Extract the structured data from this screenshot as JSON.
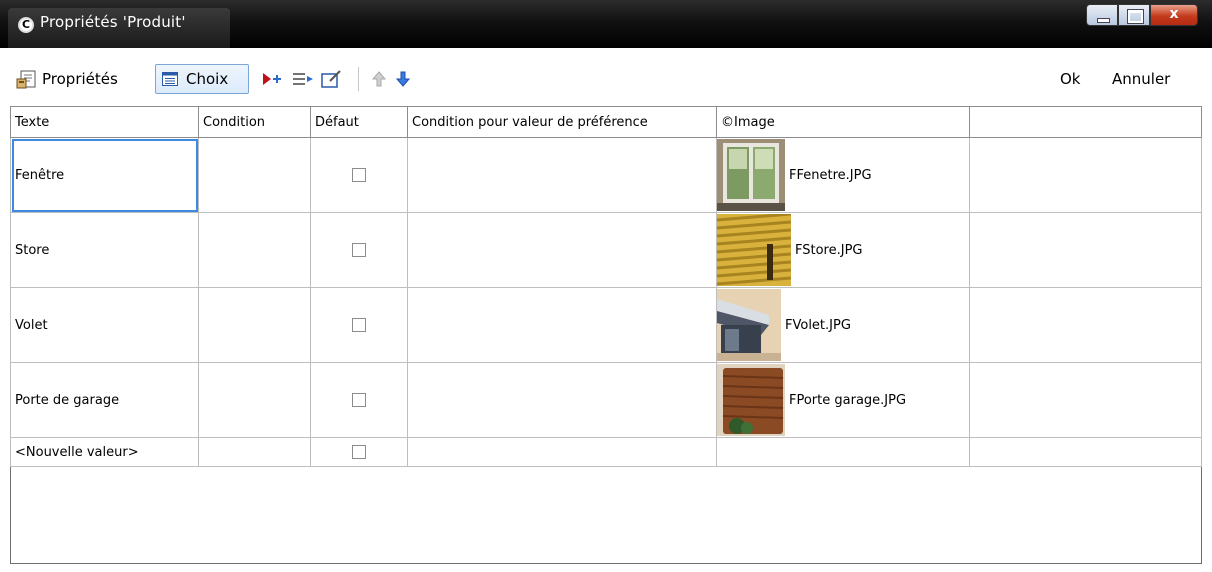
{
  "window": {
    "icon_letter": "C",
    "title": "Propriétés 'Produit'",
    "close_glyph": "x"
  },
  "toolbar": {
    "properties_label": "Propriétés",
    "choices_label": "Choix",
    "ok_label": "Ok",
    "cancel_label": "Annuler"
  },
  "table": {
    "headers": [
      "Texte",
      "Condition",
      "Défaut",
      "Condition pour valeur de préférence",
      "©Image",
      ""
    ],
    "rows": [
      {
        "text": "Fenêtre",
        "condition": "",
        "default": false,
        "preference": "",
        "image": "FFenetre.JPG"
      },
      {
        "text": "Store",
        "condition": "",
        "default": false,
        "preference": "",
        "image": "FStore.JPG"
      },
      {
        "text": "Volet",
        "condition": "",
        "default": false,
        "preference": "",
        "image": "FVolet.JPG"
      },
      {
        "text": "Porte de garage",
        "condition": "",
        "default": false,
        "preference": "",
        "image": "FPorte garage.JPG"
      }
    ],
    "new_row_text": "<Nouvelle valeur>"
  }
}
